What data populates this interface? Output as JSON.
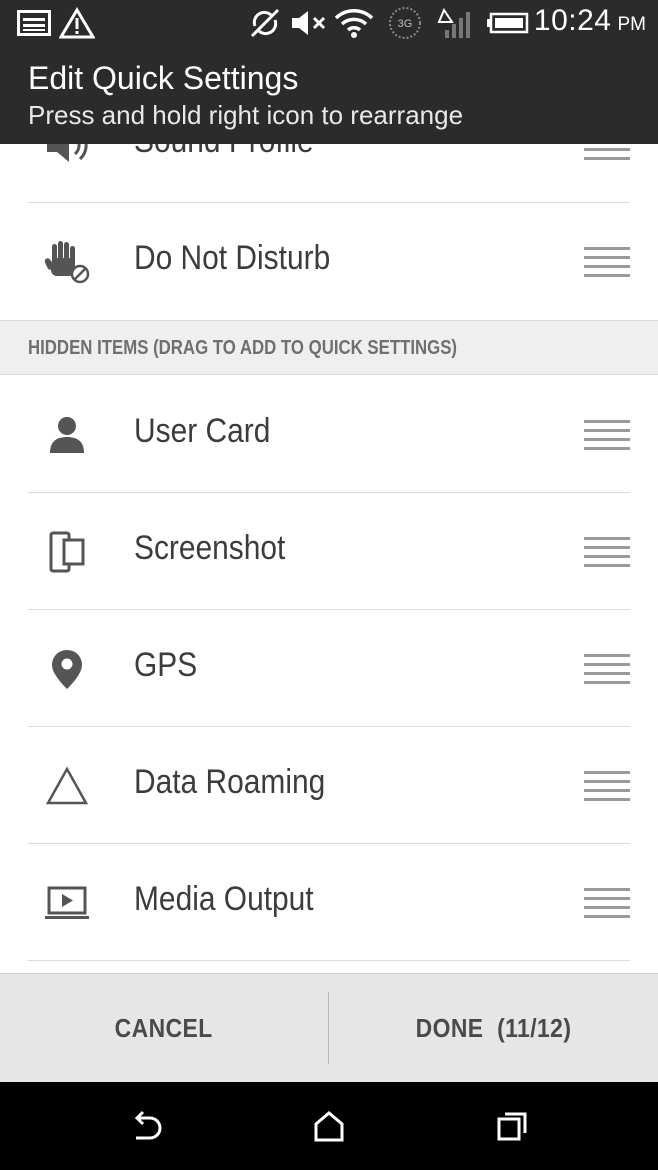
{
  "status_bar": {
    "time": "10:24",
    "ampm": "PM",
    "network_label": "3G",
    "icons": [
      "image-notification-icon",
      "warning-icon",
      "sync-off-icon",
      "mute-icon",
      "wifi-icon",
      "3g-data-icon",
      "signal-icon",
      "battery-icon"
    ]
  },
  "header": {
    "title": "Edit Quick Settings",
    "subtitle": "Press and hold right icon to rearrange"
  },
  "visible_items": [
    {
      "label": "Sound Profile",
      "icon": "speaker-icon"
    },
    {
      "label": "Do Not Disturb",
      "icon": "hand-block-icon"
    }
  ],
  "hidden_section": {
    "title": "HIDDEN ITEMS (DRAG TO ADD TO QUICK SETTINGS)"
  },
  "hidden_items": [
    {
      "label": "User Card",
      "icon": "person-icon"
    },
    {
      "label": "Screenshot",
      "icon": "screenshot-icon"
    },
    {
      "label": "GPS",
      "icon": "location-pin-icon"
    },
    {
      "label": "Data Roaming",
      "icon": "triangle-icon"
    },
    {
      "label": "Media Output",
      "icon": "media-output-icon"
    }
  ],
  "actions": {
    "cancel": "CANCEL",
    "done": "DONE  (11/12)"
  },
  "navbar": {
    "icons": [
      "back-icon",
      "home-icon",
      "recents-icon"
    ]
  },
  "colors": {
    "bar_background": "#2b2b2b",
    "section_background": "#efefef",
    "action_background": "#e6e6e6",
    "label_text": "#3c3c3c",
    "handle": "#9a9a9a"
  }
}
